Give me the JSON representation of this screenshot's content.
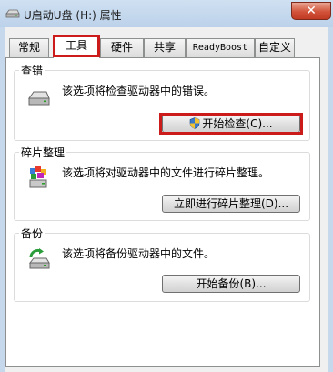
{
  "window": {
    "title": "U启动U盘 (H:) 属性",
    "close_label": "✕"
  },
  "tabs": [
    {
      "label": "常规",
      "active": false
    },
    {
      "label": "工具",
      "active": true
    },
    {
      "label": "硬件",
      "active": false
    },
    {
      "label": "共享",
      "active": false
    },
    {
      "label": "ReadyBoost",
      "active": false
    },
    {
      "label": "自定义",
      "active": false
    }
  ],
  "groups": {
    "error_check": {
      "title": "查错",
      "description": "该选项将检查驱动器中的错误。",
      "button": "开始检查(C)...",
      "icon": "drive-icon"
    },
    "defrag": {
      "title": "碎片整理",
      "description": "该选项将对驱动器中的文件进行碎片整理。",
      "button": "立即进行碎片整理(D)...",
      "icon": "defrag-icon"
    },
    "backup": {
      "title": "备份",
      "description": "该选项将备份驱动器中的文件。",
      "button": "开始备份(B)...",
      "icon": "backup-icon"
    }
  },
  "colors": {
    "highlight": "#cc1b1b",
    "close_button": "#d2533a",
    "titlebar": "#cfe0f1"
  }
}
